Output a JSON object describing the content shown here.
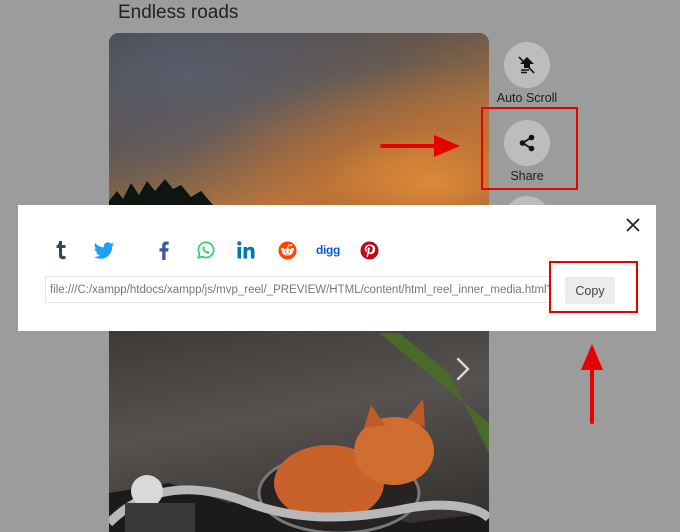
{
  "page": {
    "title": "Endless roads"
  },
  "actions": {
    "auto_scroll": {
      "label": "Auto Scroll",
      "icon": "auto-scroll-icon"
    },
    "share": {
      "label": "Share",
      "icon": "share-icon"
    }
  },
  "share_modal": {
    "social_icons": [
      "tumblr",
      "twitter",
      "facebook",
      "whatsapp",
      "linkedin",
      "reddit",
      "digg",
      "pinterest"
    ],
    "digg_text": "digg",
    "url_value": "file:///C:/xampp/htdocs/xampp/js/mvp_reel/_PREVIEW/HTML/content/html_reel_inner_media.html?mvp",
    "copy_label": "Copy"
  },
  "colors": {
    "overlay": "#9c9c9c",
    "tumblr": "#36465d",
    "twitter": "#1da1f2",
    "facebook": "#3b5998",
    "whatsapp": "#25d366",
    "linkedin": "#0077b5",
    "reddit": "#ff4500",
    "digg": "#005be2",
    "pinterest": "#bd081c",
    "annotation": "#e60000"
  }
}
